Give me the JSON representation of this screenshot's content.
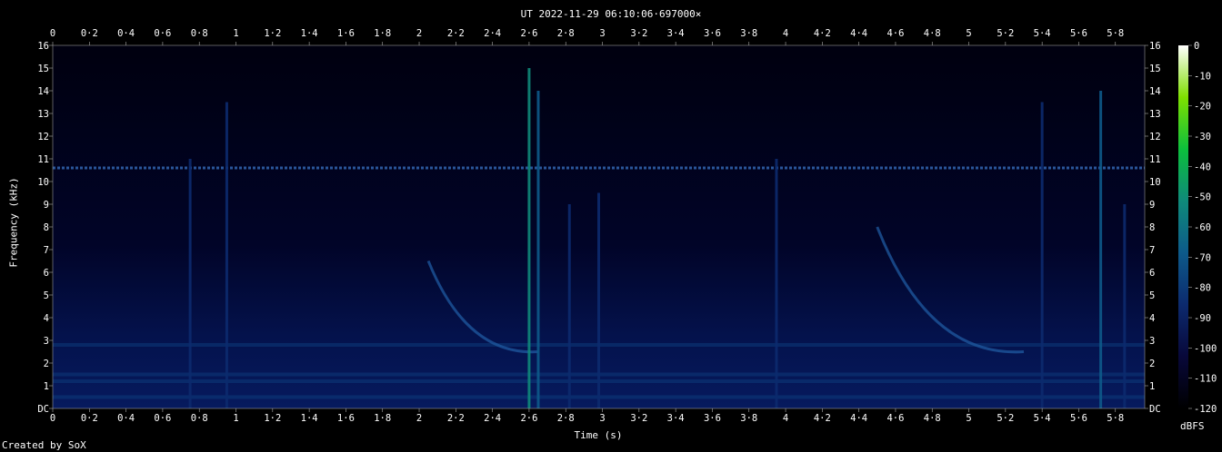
{
  "header": {
    "title": "UT 2022-11-29 06:10:06·697000×"
  },
  "footer": {
    "credit": "Created by SoX"
  },
  "colorbar": {
    "unit": "dBFS",
    "ticks": [
      "0",
      "-10",
      "-20",
      "-30",
      "-40",
      "-50",
      "-60",
      "-70",
      "-80",
      "-90",
      "-100",
      "-110",
      "-120"
    ],
    "colors": [
      "#000000",
      "#08083a",
      "#0c2a6e",
      "#0d5a8a",
      "#0f8a7a",
      "#0cbf3c",
      "#7fe000",
      "#ffffff"
    ]
  },
  "chart_data": {
    "type": "heatmap",
    "title": "UT 2022-11-29 06:10:06·697000×",
    "xlabel": "Time (s)",
    "ylabel": "Frequency (kHz)",
    "xlim": [
      0,
      5.96
    ],
    "ylim": [
      0,
      16
    ],
    "zlim": [
      -120,
      0
    ],
    "x_ticks": [
      "0",
      "0·2",
      "0·4",
      "0·6",
      "0·8",
      "1",
      "1·2",
      "1·4",
      "1·6",
      "1·8",
      "2",
      "2·2",
      "2·4",
      "2·6",
      "2·8",
      "3",
      "3·2",
      "3·4",
      "3·6",
      "3·8",
      "4",
      "4·2",
      "4·4",
      "4·6",
      "4·8",
      "5",
      "5·2",
      "5·4",
      "5·6",
      "5·8"
    ],
    "y_ticks": [
      "DC",
      "1",
      "2",
      "3",
      "4",
      "5",
      "6",
      "7",
      "8",
      "9",
      "10",
      "11",
      "12",
      "13",
      "14",
      "15",
      "16"
    ],
    "features": {
      "tone_khz": 10.6,
      "low_bands_khz": [
        0.5,
        1.2,
        1.5,
        2.8
      ],
      "bursts": [
        {
          "t": 0.75,
          "f_max": 11,
          "level": -80
        },
        {
          "t": 0.95,
          "f_max": 13.5,
          "level": -90
        },
        {
          "t": 2.6,
          "f_max": 15,
          "level": -60
        },
        {
          "t": 2.65,
          "f_max": 14,
          "level": -65
        },
        {
          "t": 2.82,
          "f_max": 9,
          "level": -85
        },
        {
          "t": 2.98,
          "f_max": 9.5,
          "level": -80
        },
        {
          "t": 3.95,
          "f_max": 11,
          "level": -90
        },
        {
          "t": 5.4,
          "f_max": 13.5,
          "level": -80
        },
        {
          "t": 5.72,
          "f_max": 14,
          "level": -75
        },
        {
          "t": 5.85,
          "f_max": 9,
          "level": -90
        }
      ],
      "whistlers": [
        {
          "t_start": 2.05,
          "t_end": 2.65,
          "f_start": 6.5,
          "f_end": 2.5
        },
        {
          "t_start": 4.5,
          "t_end": 5.3,
          "f_start": 8,
          "f_end": 2.5
        }
      ]
    }
  }
}
